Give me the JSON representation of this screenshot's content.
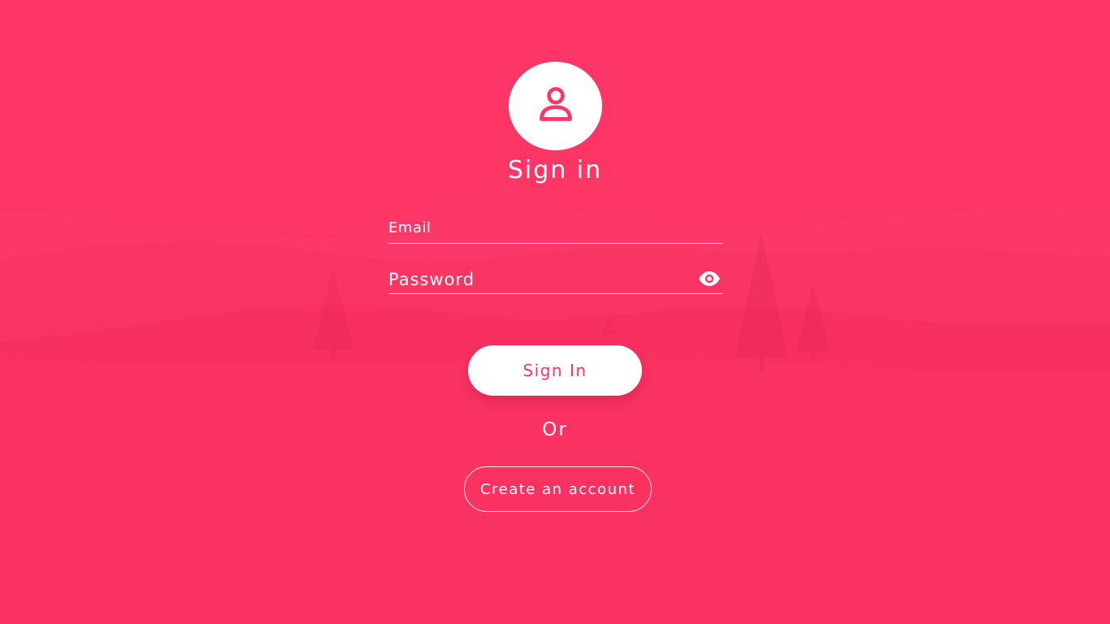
{
  "colors": {
    "accent": "#ff3565",
    "text": "#ffffff",
    "button_bg": "#ffffff"
  },
  "header": {
    "avatar_icon": "user-icon",
    "title": "Sign in"
  },
  "form": {
    "email": {
      "placeholder": "Email",
      "value": ""
    },
    "password": {
      "placeholder": "Password",
      "value": "",
      "toggle_icon": "eye-icon"
    },
    "submit_label": "Sign In",
    "separator": "Or",
    "create_account_label": "Create an account"
  }
}
